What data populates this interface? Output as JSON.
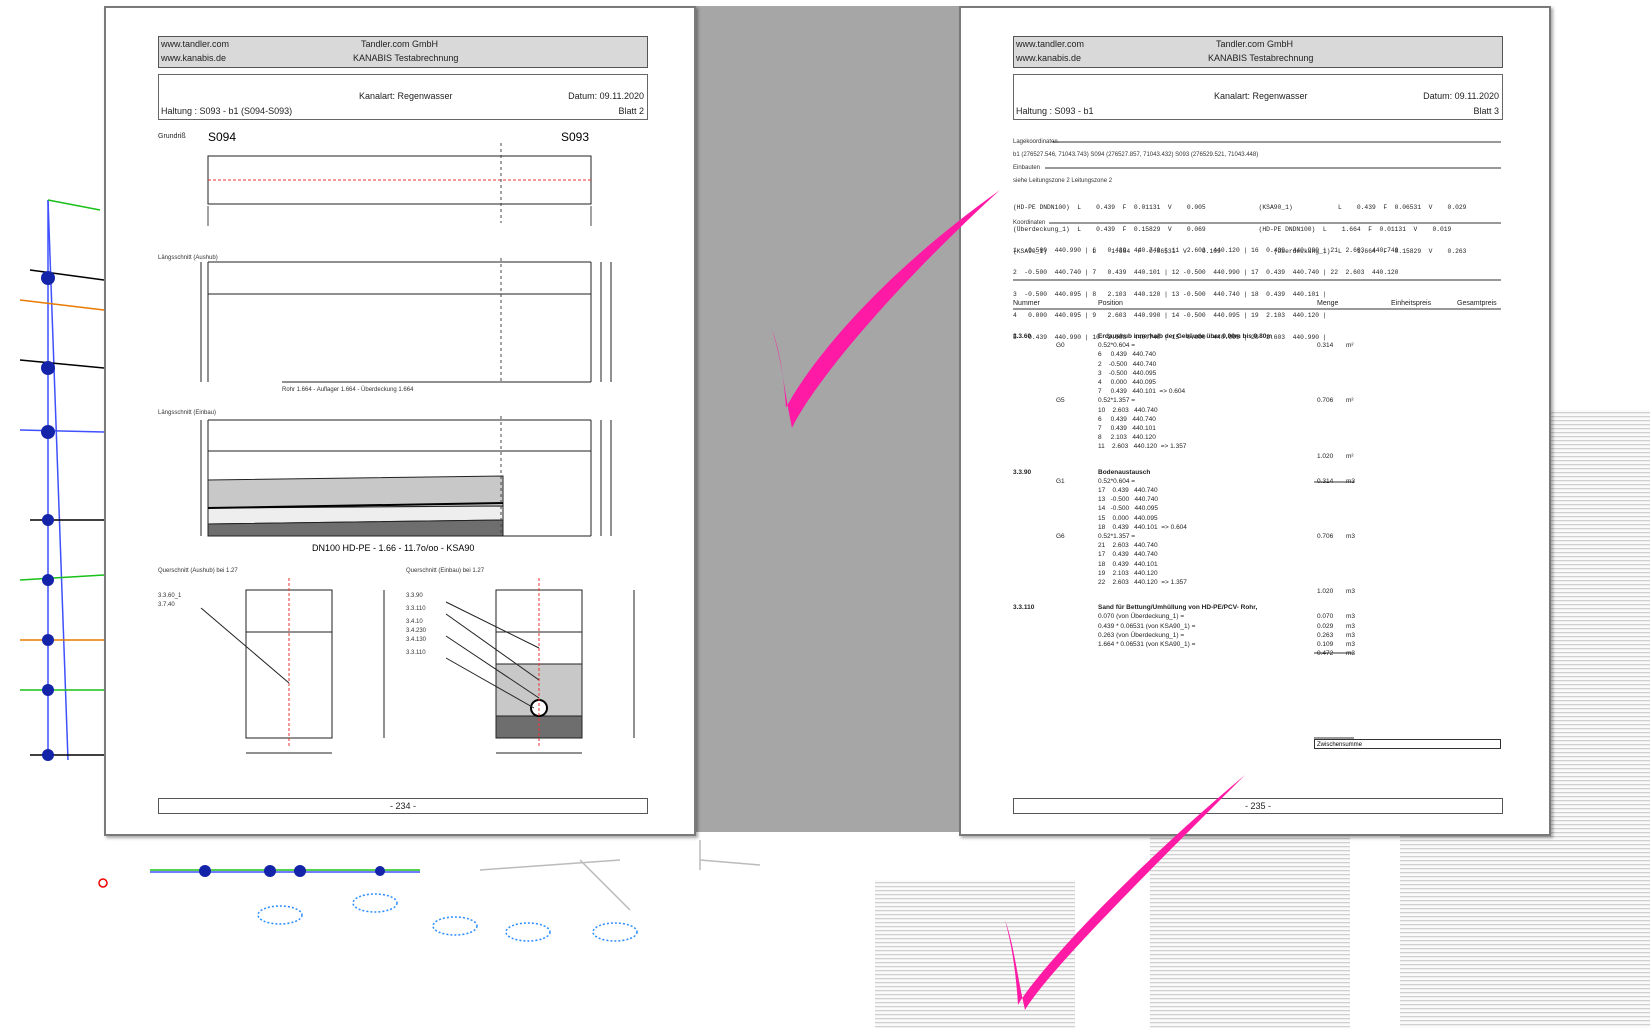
{
  "header": {
    "url1": "www.tandler.com",
    "url2": "www.kanabis.de",
    "company": "Tandler.com GmbH",
    "product": "KANABIS Testabrechnung"
  },
  "left_page": {
    "kanalart": "Kanalart: Regenwasser",
    "datum": "Datum: 09.11.2020",
    "haltung": "Haltung : S093 - b1    (S094-S093)",
    "blatt": "Blatt 2",
    "grundriss_label": "Grundriß",
    "node_left": "S094",
    "node_right": "S093",
    "ls_aushub_label": "Längsschnitt (Aushub)",
    "ls_aushub_caption": "Rohr 1.664 - Auflager 1.664 - Überdeckung 1.664",
    "ls_einbau_label": "Längsschnitt (Einbau)",
    "ls_einbau_caption": "DN100 HD-PE - 1.66 - 11.7o/oo - KSA90",
    "qs_aushub_label": "Querschnitt (Aushub) bei 1.27",
    "qs_einbau_label": "Querschnitt (Einbau) bei 1.27",
    "qs_aushub_pos": [
      "3.3.60_1",
      "3.7.40"
    ],
    "qs_einbau_pos": [
      "3.3.90",
      "3.3.110",
      "3.4.10",
      "3.4.230",
      "3.4.130",
      "3.3.110"
    ],
    "page_number": "- 234 -"
  },
  "right_page": {
    "kanalart": "Kanalart: Regenwasser",
    "datum": "Datum: 09.11.2020",
    "haltung": "Haltung : S093 - b1",
    "blatt": "Blatt 3",
    "lagekoordinaten_label": "Lagekoordinaten",
    "lagekoordinaten": "b1 (276527.546, 71043.743)   S094 (276527.857, 71043.432)   S093 (276529.521, 71043.448)",
    "einbauten_label": "Einbauten",
    "einbauten_note": "siehe Leitungszone 2 Leitungszone 2",
    "einbauten_rows": [
      "(HD-PE DNDN100)  L    0.439  F  0.01131  V    0.005              (KSA90_1)            L    0.439  F  0.06531  V    0.029",
      "(Überdeckung_1)  L    0.439  F  0.15829  V    0.069              (HD-PE DNDN100)  L    1.664  F  0.01131  V    0.019",
      "(KSA90_1)            L    1.664  F  0.06531  V    0.109              (Überdeckung_1)  L    1.664  F  0.15829  V    0.263"
    ],
    "koordinaten_label": "Koordinaten",
    "koordinaten_rows": [
      "1  -0.500  440.990 | 6   0.439  440.740 | 11  2.603  440.120 | 16  0.439  440.990 | 21  2.603  440.740",
      "2  -0.500  440.740 | 7   0.439  440.101 | 12 -0.500  440.990 | 17  0.439  440.740 | 22  2.603  440.120",
      "3  -0.500  440.095 | 8   2.103  440.120 | 13 -0.500  440.740 | 18  0.439  440.101 |",
      "4   0.000  440.095 | 9   2.603  440.990 | 14 -0.500  440.095 | 19  2.103  440.120 |",
      "5   0.439  440.990 | 10  2.603  440.740 | 15  0.000  440.095 | 20  2.603  440.990 |"
    ],
    "table_headers": {
      "nummer": "Nummer",
      "position": "Position",
      "menge": "Menge",
      "einheitspreis": "Einheitspreis",
      "gesamtpreis": "Gesamtpreis"
    },
    "lines": [
      {
        "nr": "3.3.60",
        "pos": "Erdaushub innerhalb der Gebäude über 0.00m bis 0.80m",
        "menge": "",
        "unit": "",
        "bold": true
      },
      {
        "code": "G0",
        "pos": "0.52*0.604 =",
        "menge": "0.314",
        "unit": "m²"
      },
      {
        "pos": "6     0.439   440.740"
      },
      {
        "pos": "2    -0.500   440.740"
      },
      {
        "pos": "3    -0.500   440.095"
      },
      {
        "pos": "4     0.000   440.095"
      },
      {
        "pos": "7     0.439   440.101  => 0.604"
      },
      {
        "code": "G5",
        "pos": "0.52*1.357 =",
        "menge": "0.706",
        "unit": "m²"
      },
      {
        "pos": "10    2.603   440.740"
      },
      {
        "pos": "6     0.439   440.740"
      },
      {
        "pos": "7     0.439   440.101"
      },
      {
        "pos": "8     2.103   440.120"
      },
      {
        "pos": "11    2.603   440.120  => 1.357"
      },
      {
        "menge": "1.020",
        "unit": "m²",
        "sum": true
      },
      {
        "nr": "3.3.90",
        "pos": "Bodenaustausch",
        "bold": true
      },
      {
        "code": "G1",
        "pos": "0.52*0.604 =",
        "menge": "0.314",
        "unit": "m3"
      },
      {
        "pos": "17    0.439   440.740"
      },
      {
        "pos": "13   -0.500   440.740"
      },
      {
        "pos": "14   -0.500   440.095"
      },
      {
        "pos": "15    0.000   440.095"
      },
      {
        "pos": "18    0.439   440.101  => 0.604"
      },
      {
        "code": "G6",
        "pos": "0.52*1.357 =",
        "menge": "0.706",
        "unit": "m3"
      },
      {
        "pos": "21    2.603   440.740"
      },
      {
        "pos": "17    0.439   440.740"
      },
      {
        "pos": "18    0.439   440.101"
      },
      {
        "pos": "19    2.103   440.120"
      },
      {
        "pos": "22    2.603   440.120  => 1.357"
      },
      {
        "menge": "1.020",
        "unit": "m3",
        "sum": true
      },
      {
        "nr": "3.3.110",
        "pos": "Sand für Bettung/Umhüllung von HD-PE/PCV- Rohr,",
        "bold": true
      },
      {
        "pos": "0.070 (von Überdeckung_1) =",
        "menge": "0.070",
        "unit": "m3"
      },
      {
        "pos": "0.439 * 0.06531 (von KSA90_1) =",
        "menge": "0.029",
        "unit": "m3"
      },
      {
        "pos": "0.263 (von Überdeckung_1) =",
        "menge": "0.263",
        "unit": "m3"
      },
      {
        "pos": "1.664 * 0.06531 (von KSA90_1) =",
        "menge": "0.109",
        "unit": "m3"
      },
      {
        "menge": "0.472",
        "unit": "m3",
        "sum": true
      }
    ],
    "zwischensumme": "Zwischensumme",
    "page_number": "- 235 -"
  },
  "colors": {
    "check": "#ff1aa6",
    "center_gray": "#a6a6a6",
    "page_border": "#7a7a7a"
  }
}
